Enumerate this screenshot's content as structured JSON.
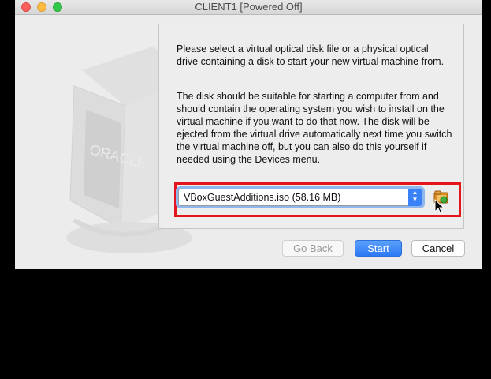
{
  "window": {
    "title": "CLIENT1 [Powered Off]"
  },
  "watermark": {
    "brand": "ORACLE"
  },
  "instructions": {
    "paragraph1": "Please select a virtual optical disk file or a physical optical drive containing a disk to start your new virtual machine from.",
    "paragraph2": "The disk should be suitable for starting a computer from and should contain the operating system you wish to install on the virtual machine if you want to do that now. The disk will be ejected from the virtual drive automatically next time you switch the virtual machine off, but you can also do this yourself if needed using the Devices menu."
  },
  "disk_selector": {
    "selected": "VBoxGuestAdditions.iso (58.16 MB)"
  },
  "buttons": {
    "back": "Go Back",
    "start": "Start",
    "cancel": "Cancel"
  },
  "icons": {
    "folder": "folder-open-icon",
    "stepper": "up-down-chevron-icon"
  },
  "colors": {
    "highlight": "#e3151a",
    "accent": "#3a82f7"
  }
}
